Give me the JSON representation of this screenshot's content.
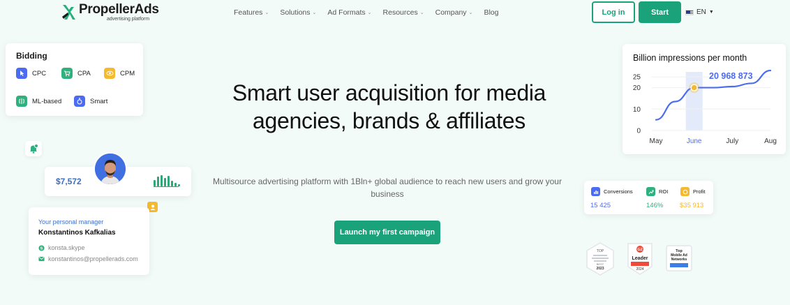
{
  "header": {
    "logo_name": "PropellerAds",
    "logo_tagline": "advertising platform",
    "nav": [
      "Features",
      "Solutions",
      "Ad Formats",
      "Resources",
      "Company",
      "Blog"
    ],
    "login_label": "Log in",
    "start_label": "Start",
    "language": "EN"
  },
  "bidding": {
    "title": "Bidding",
    "options": [
      {
        "label": "CPC",
        "icon": "cursor-icon",
        "color": "#4b6cf0"
      },
      {
        "label": "CPA",
        "icon": "cart-icon",
        "color": "#2fb07f"
      },
      {
        "label": "CPM",
        "icon": "eye-icon",
        "color": "#f5b92e"
      },
      {
        "label": "ML-based",
        "icon": "brain-icon",
        "color": "#2fb07f"
      },
      {
        "label": "Smart",
        "icon": "smart-icon",
        "color": "#4b6cf0"
      }
    ]
  },
  "stat_value": "$7,572",
  "manager": {
    "role": "Your personal manager",
    "name": "Konstantinos Kafkalias",
    "skype": "konsta.skype",
    "email": "konstantinos@propellerads.com"
  },
  "hero": {
    "title": "Smart user acquisition for media agencies, brands & affiliates",
    "subtitle": "Multisource advertising platform with 1Bln+ global audience to reach new users and grow your business",
    "cta": "Launch my first campaign"
  },
  "impressions_card": {
    "title": "Billion impressions per month",
    "highlight_value": "20 968 873"
  },
  "chart_data": {
    "type": "line",
    "title": "Billion impressions per month",
    "categories": [
      "May",
      "June",
      "July",
      "Aug"
    ],
    "highlight_category": "June",
    "yticks": [
      0,
      10,
      20,
      25
    ],
    "ylim": [
      0,
      28
    ],
    "values": [
      5,
      13.5,
      20,
      20,
      20.5,
      22,
      28
    ],
    "x_positions_relative": [
      0,
      0.5,
      1,
      1.5,
      2,
      2.5,
      3
    ],
    "series_color": "#4b6cf0",
    "highlight_color": "#f5b92e",
    "grid": true
  },
  "metrics": [
    {
      "label": "Conversions",
      "value": "15 425",
      "color": "#4b6cf0",
      "icon": "bar-chart-icon"
    },
    {
      "label": "ROI",
      "value": "146%",
      "color": "#2fb07f",
      "icon": "trend-up-icon"
    },
    {
      "label": "Profit",
      "value": "$35 913",
      "color": "#f5b92e",
      "icon": "coin-icon"
    }
  ],
  "badges": [
    {
      "name": "top-apps-badge",
      "text": [
        "TOP",
        "BEST",
        "2023"
      ]
    },
    {
      "name": "g2-leader-badge",
      "text": [
        "Leader",
        "2024"
      ]
    },
    {
      "name": "top-mobile-ad-networks-badge",
      "text": [
        "Top",
        "Mobile Ad",
        "Networks"
      ]
    }
  ]
}
